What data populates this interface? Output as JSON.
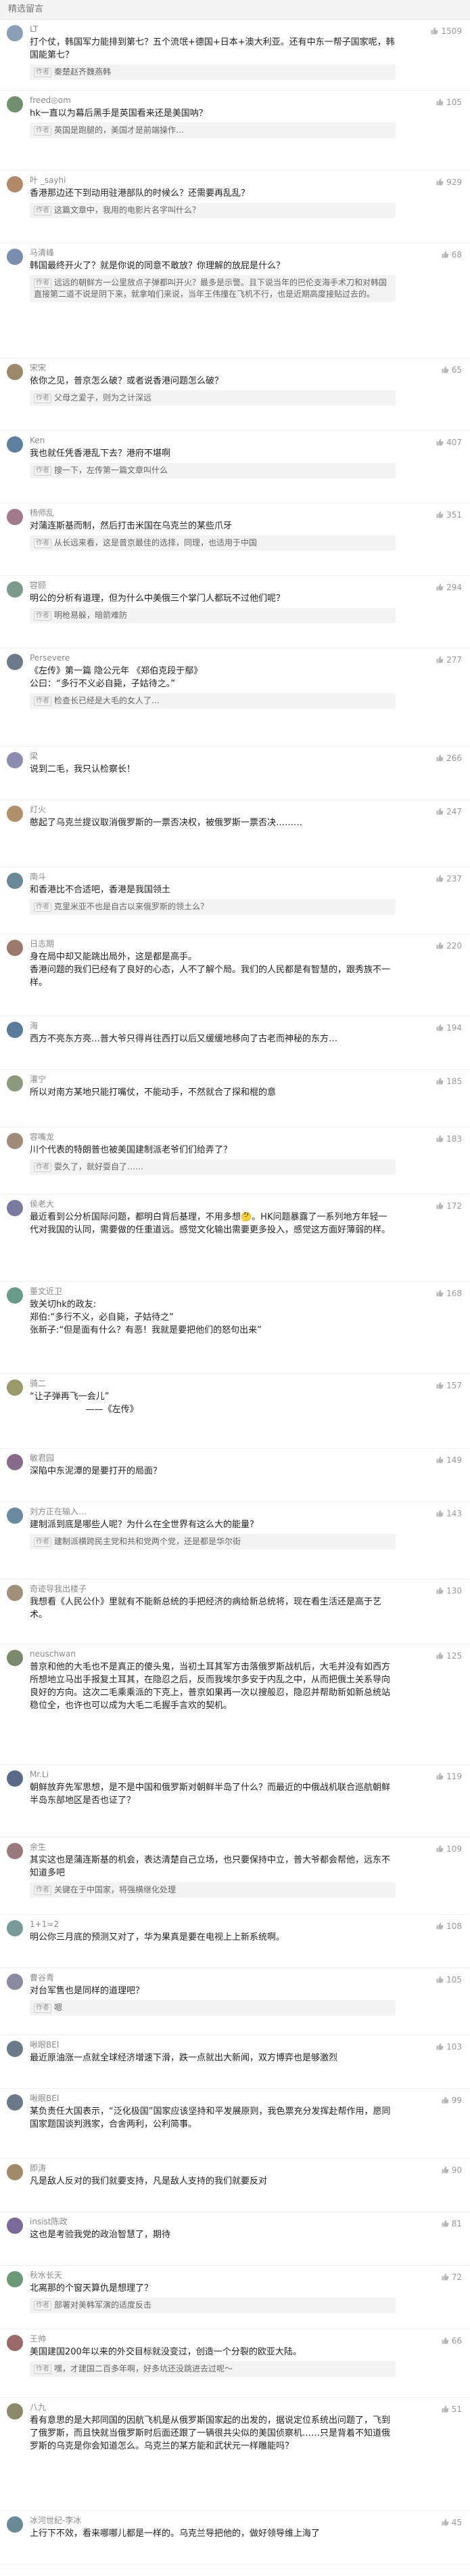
{
  "header": {
    "title": "精选留言"
  },
  "icons": {
    "like": "thumbs-up-icon",
    "avatar": "user-avatar"
  },
  "comments": [
    {
      "name": "LT",
      "likes": "1509",
      "avatar_color": "#8aa0b8",
      "text": "打个仗，韩国军力能排到第七？五个流氓+德国+日本+澳大利亚。还有中东一帮子国家呢，韩国能第七？",
      "reply": "秦楚赵齐魏燕韩"
    },
    {
      "name": "freed◎om",
      "likes": "105",
      "avatar_color": "#6f8f6f",
      "text": "hk一直以为幕后黑手是英国看来还是美国呐？",
      "reply": "英国是跑腿的，美国才是前端操作…"
    },
    {
      "name": "叶 _sayhi",
      "likes": "929",
      "avatar_color": "#b08a6a",
      "text": "香港那边还下到动用驻港部队的时候么？还需要再乱乱？",
      "reply": "这篇文章中，我用的电影片名字叫什么？"
    },
    {
      "name": "马清峰",
      "likes": "68",
      "avatar_color": "#7a8fb0",
      "text": "韩国最终开火了？就是你说的同意不敢放？你理解的放屁是什么？",
      "reply": "远远的朝鲜方一公里放点子弹都叫开火？最多是示警。且下说当年的巴伦支海手术刀和对韩国直接第二道不说是阴下来，就拿咱们来说，当年王伟撞在飞机不行，也是近期高度接贴过去的。"
    },
    {
      "name": "宋宋",
      "likes": "65",
      "avatar_color": "#9a8a6a",
      "text": "依你之见，普京怎么破？或者说香港问题怎么破？",
      "reply": "父母之爱子，则为之计深远"
    },
    {
      "name": "Ken",
      "likes": "407",
      "avatar_color": "#5f7f9f",
      "text": "我也就任凭香港乱下去？港府不堪啊",
      "reply": "搜一下，左传第一篇文章叫什么"
    },
    {
      "name": "杨师乱",
      "likes": "351",
      "avatar_color": "#a07a8a",
      "text": "对蒲连斯基而制，然后打击米国在乌克兰的某些爪牙",
      "reply": "从长远来看，这是普京最佳的选择，同理，也适用于中国"
    },
    {
      "name": "容颐",
      "likes": "294",
      "avatar_color": "#7b9a8c",
      "text": "明公的分析有道理，但为什么中美俄三个掌门人都玩不过他们呢？",
      "reply": "明枪易躲，暗箭难防"
    },
    {
      "name": "Persevere",
      "likes": "277",
      "avatar_color": "#6c7a8a",
      "text": "《左传》第一篇 隐公元年 《郑伯克段于鄢》\n公曰：“多行不义必自毙，子姑待之。”",
      "reply": "检查长已经是大毛的女人了…"
    },
    {
      "name": "梁",
      "likes": "266",
      "avatar_color": "#8c8cb0",
      "text": "说到二毛，我只认检察长！",
      "reply": ""
    },
    {
      "name": "灯火",
      "likes": "247",
      "avatar_color": "#b0906a",
      "text": "憨起了乌克兰提议取消俄罗斯的一票否决权，被俄罗斯一票否决………",
      "reply": ""
    },
    {
      "name": "南斗",
      "likes": "237",
      "avatar_color": "#6a8a9a",
      "text": "和香港比不合适吧，香港是我国领土",
      "reply": "克里米亚不也是自古以来俄罗斯的领土么？"
    },
    {
      "name": "日志期",
      "likes": "220",
      "avatar_color": "#9a7a6a",
      "text": "身在局中却又能跳出局外，这是都是高手。\n香港问题的我们已经有了良好的心态，人不了解个局。我们的人民都是有智慧的，跟秀族不一样。",
      "reply": ""
    },
    {
      "name": "海",
      "likes": "194",
      "avatar_color": "#5a7a9a",
      "text": "西方不亮东方亮…普大爷只得肖往西打以后又缓缓地移向了古老而神秘的东方…",
      "reply": ""
    },
    {
      "name": "灌宁",
      "likes": "185",
      "avatar_color": "#8a9a7a",
      "text": "所以对南方某地只能打嘴仗，不能动手，不然就合了探和棍的意",
      "reply": ""
    },
    {
      "name": "容嘴龙",
      "likes": "183",
      "avatar_color": "#a08a7a",
      "text": "川个代表的特朗普也被美国建制派老爷们们给弄了？",
      "reply": "耍久了，就好耍自了……"
    },
    {
      "name": "侯老大",
      "likes": "172",
      "avatar_color": "#7a7aa0",
      "text": "最近看到公分析国际问题，都明白背后基理，不用多想🤔。HK问题暴露了一系列地方年轻一代对我国的认同，需要做的任重道远。感觉文化输出需要更多投入，感觉这方面好薄弱的样。",
      "reply": ""
    },
    {
      "name": "董文近卫",
      "likes": "168",
      "avatar_color": "#6a9a8a",
      "text": "致关切hk的政友:\n郑伯:“多行不义，必自毙，子姑待之”\n张新子:“但是面有什么？有恶！我就是要把他们的怒句出来”",
      "reply": ""
    },
    {
      "name": "骑二",
      "likes": "157",
      "avatar_color": "#9a9a6a",
      "text": "“让子弹再飞一会儿”\n                    ——《左传》",
      "reply": ""
    },
    {
      "name": "敏君园",
      "likes": "149",
      "avatar_color": "#8a6a8a",
      "text": "深陷中东泥潭的是要打开的局面？",
      "reply": ""
    },
    {
      "name": "刘方正在输入…",
      "likes": "143",
      "avatar_color": "#6a8aa0",
      "text": "建制派到底是哪些人呢？为什么在全世界有这么大的能量?",
      "reply": "建制派横跨民主党和共和党两个党，还是都是华尔街"
    },
    {
      "name": "奇迹导我出楼子",
      "likes": "130",
      "avatar_color": "#a0907a",
      "text": "我想看《人民公仆》里就有不能新总统的手把经济的病给新总统将，现在看生活还是高于艺术。",
      "reply": ""
    },
    {
      "name": "neuschwan",
      "likes": "125",
      "avatar_color": "#7a8a6a",
      "text": "普京和他的大毛也不是真正的傻头鬼，当初土耳其军方击落俄罗斯战机后，大毛并没有如西方所想地立马出手报复土耳其，在隐忍之后，反而我埃尔多安于内乱之中，从而把俄土关系导向良好的方向。这次二毛乘乘派的下克上，普京如果再一次以搜般忍，隐忍并帮助新如新总统站稳位全，也许也可以成为大毛二毛握手言欢的契机。",
      "reply": ""
    },
    {
      "name": "Mr.Li",
      "likes": "119",
      "avatar_color": "#5a6a8a",
      "text": "朝鲜放弃先军思想，是不是中国和俄罗斯对朝鲜半岛了什么？而最近的中俄战机联合巡航朝鲜半岛东部地区是否也证了？",
      "reply": ""
    },
    {
      "name": "余生",
      "likes": "109",
      "avatar_color": "#9a7a7a",
      "text": "其实这也是蒲连斯基的机会，表达清楚自己立场，也只要保持中立，普大爷都会帮他，远东不知道多吧",
      "reply": "关键在于中国家，将强横继化处理"
    },
    {
      "name": "1+1=2",
      "likes": "108",
      "avatar_color": "#7a9a9a",
      "text": "明公你三月底的预测又对了，华为果真是要在电视上上新系统啊。",
      "reply": ""
    },
    {
      "name": "曹谷青",
      "likes": "105",
      "avatar_color": "#8a8aa0",
      "text": "对台军售也是同样的道理吧？",
      "reply": "嗯"
    },
    {
      "name": "啾眼BEI",
      "likes": "103",
      "avatar_color": "#6a7a8a",
      "text": "最近原油涨一点就全球经济增速下滑，跌一点就出大新闻，双方博弈也是够激烈",
      "reply": ""
    },
    {
      "name": "啾眼BEI",
      "likes": "99",
      "avatar_color": "#6a7a8a",
      "text": "某负责任大国表示，“泛化极国”国家应该坚持和平发展原则，我色票充分发挥赴帮作用，愿同国家题国谈判溅家，合舍两利，公利简事。",
      "reply": ""
    },
    {
      "name": "即涛",
      "likes": "90",
      "avatar_color": "#a08a6a",
      "text": "凡是敌人反对的我们就要支持，凡是敌人支持的我们就要反对",
      "reply": ""
    },
    {
      "name": "insist陈政",
      "likes": "81",
      "avatar_color": "#7a6a9a",
      "text": "这也是考验我党的政治智慧了，期待",
      "reply": ""
    },
    {
      "name": "秋水长天",
      "likes": "72",
      "avatar_color": "#6a9a7a",
      "text": "北离那的个窗天算仇是想理了？",
      "reply": "部署对美韩军演的适度反击"
    },
    {
      "name": "王帅",
      "likes": "66",
      "avatar_color": "#9a6a6a",
      "text": "美国建国200年以来的外交目标就没变过，创造一个分裂的欧亚大陆。",
      "reply": "嘿，才建国二百多年啊，好多坑还没跳进去过呢～"
    },
    {
      "name": "八九",
      "likes": "51",
      "avatar_color": "#8a8a6a",
      "text": "看有意思的是大邦同国的因航飞机是从俄罗斯国家起的出发的，据说定位系统出问题了，飞到了俄罗斯，而且快就当俄罗斯时后面还跟了一辆很共尖似的美国侦察机……只是背着不知道俄罗斯的乌克是你会知道怎么。乌克兰的某方能和武状元一样雕能吗？",
      "reply": ""
    },
    {
      "name": "冰河世纪-李冰",
      "likes": "45",
      "avatar_color": "#6a8a9a",
      "text": "上行下不效，看来哪哪儿都是一样的。乌克兰导把他的，做好领导维上海了",
      "reply": ""
    }
  ],
  "author_tag": "作者"
}
